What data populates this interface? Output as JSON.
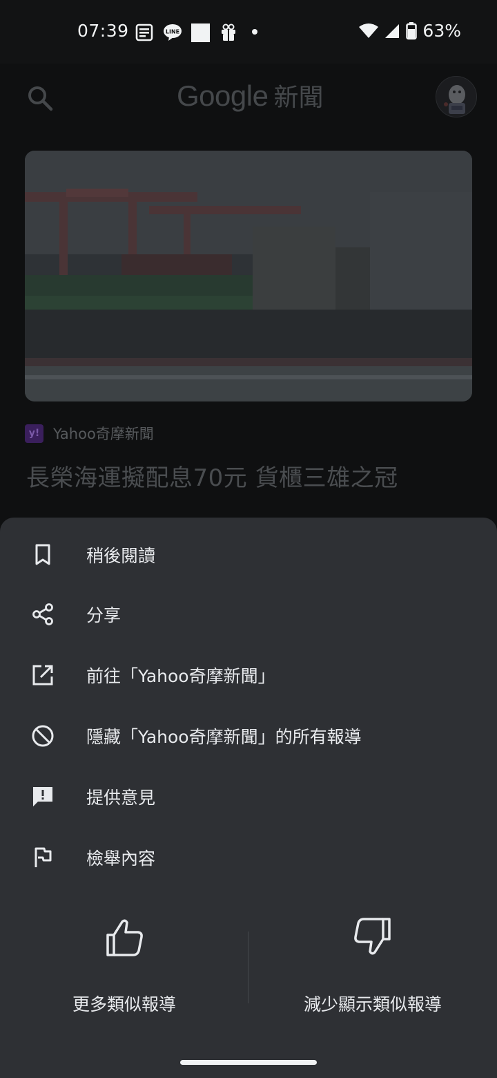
{
  "status_bar": {
    "time": "07:39",
    "notification_icons": [
      "news-notification-icon",
      "line-app-icon",
      "square-notification-icon",
      "gift-icon",
      "dot-icon"
    ],
    "battery_percent": "63%"
  },
  "app_bar": {
    "title_brand": "Google",
    "title_suffix": "新聞"
  },
  "article": {
    "source": "Yahoo奇摩新聞",
    "source_logo_text": "y!",
    "headline": "長榮海運擬配息70元 貨櫃三雄之冠"
  },
  "sheet": {
    "items": [
      {
        "label": "稍後閱讀",
        "icon": "bookmark-icon"
      },
      {
        "label": "分享",
        "icon": "share-icon"
      },
      {
        "label": "前往「Yahoo奇摩新聞」",
        "icon": "open-external-icon"
      },
      {
        "label": "隱藏「Yahoo奇摩新聞」的所有報導",
        "icon": "block-icon"
      },
      {
        "label": "提供意見",
        "icon": "feedback-icon"
      },
      {
        "label": "檢舉內容",
        "icon": "flag-icon"
      }
    ],
    "more_like_this": "更多類似報導",
    "fewer_like_this": "減少顯示類似報導"
  },
  "colors": {
    "sheet_bg": "#2e3034",
    "text_primary": "#e8eaed",
    "dim_background": "#0f1011"
  }
}
